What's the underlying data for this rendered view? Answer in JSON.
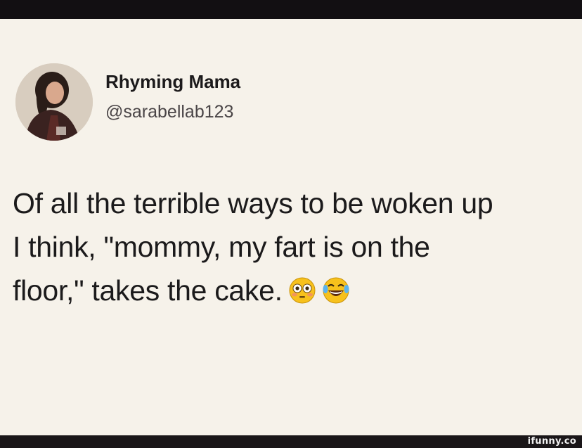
{
  "profile": {
    "display_name": "Rhyming Mama",
    "handle": "@sarabellab123",
    "avatar_icon": "profile-photo"
  },
  "tweet": {
    "lines": [
      "Of all the terrible ways to be woken up",
      "I think, \"mommy, my fart is on the",
      "floor,\" takes the cake."
    ],
    "emojis": [
      "flushed-face-icon",
      "laughing-tears-face-icon"
    ]
  },
  "watermark": {
    "text": "ifunny.co"
  },
  "colors": {
    "background": "#f6f2ea",
    "bar": "#120f12",
    "text": "#1b1a1b",
    "emoji_yellow": "#f7c11c"
  }
}
